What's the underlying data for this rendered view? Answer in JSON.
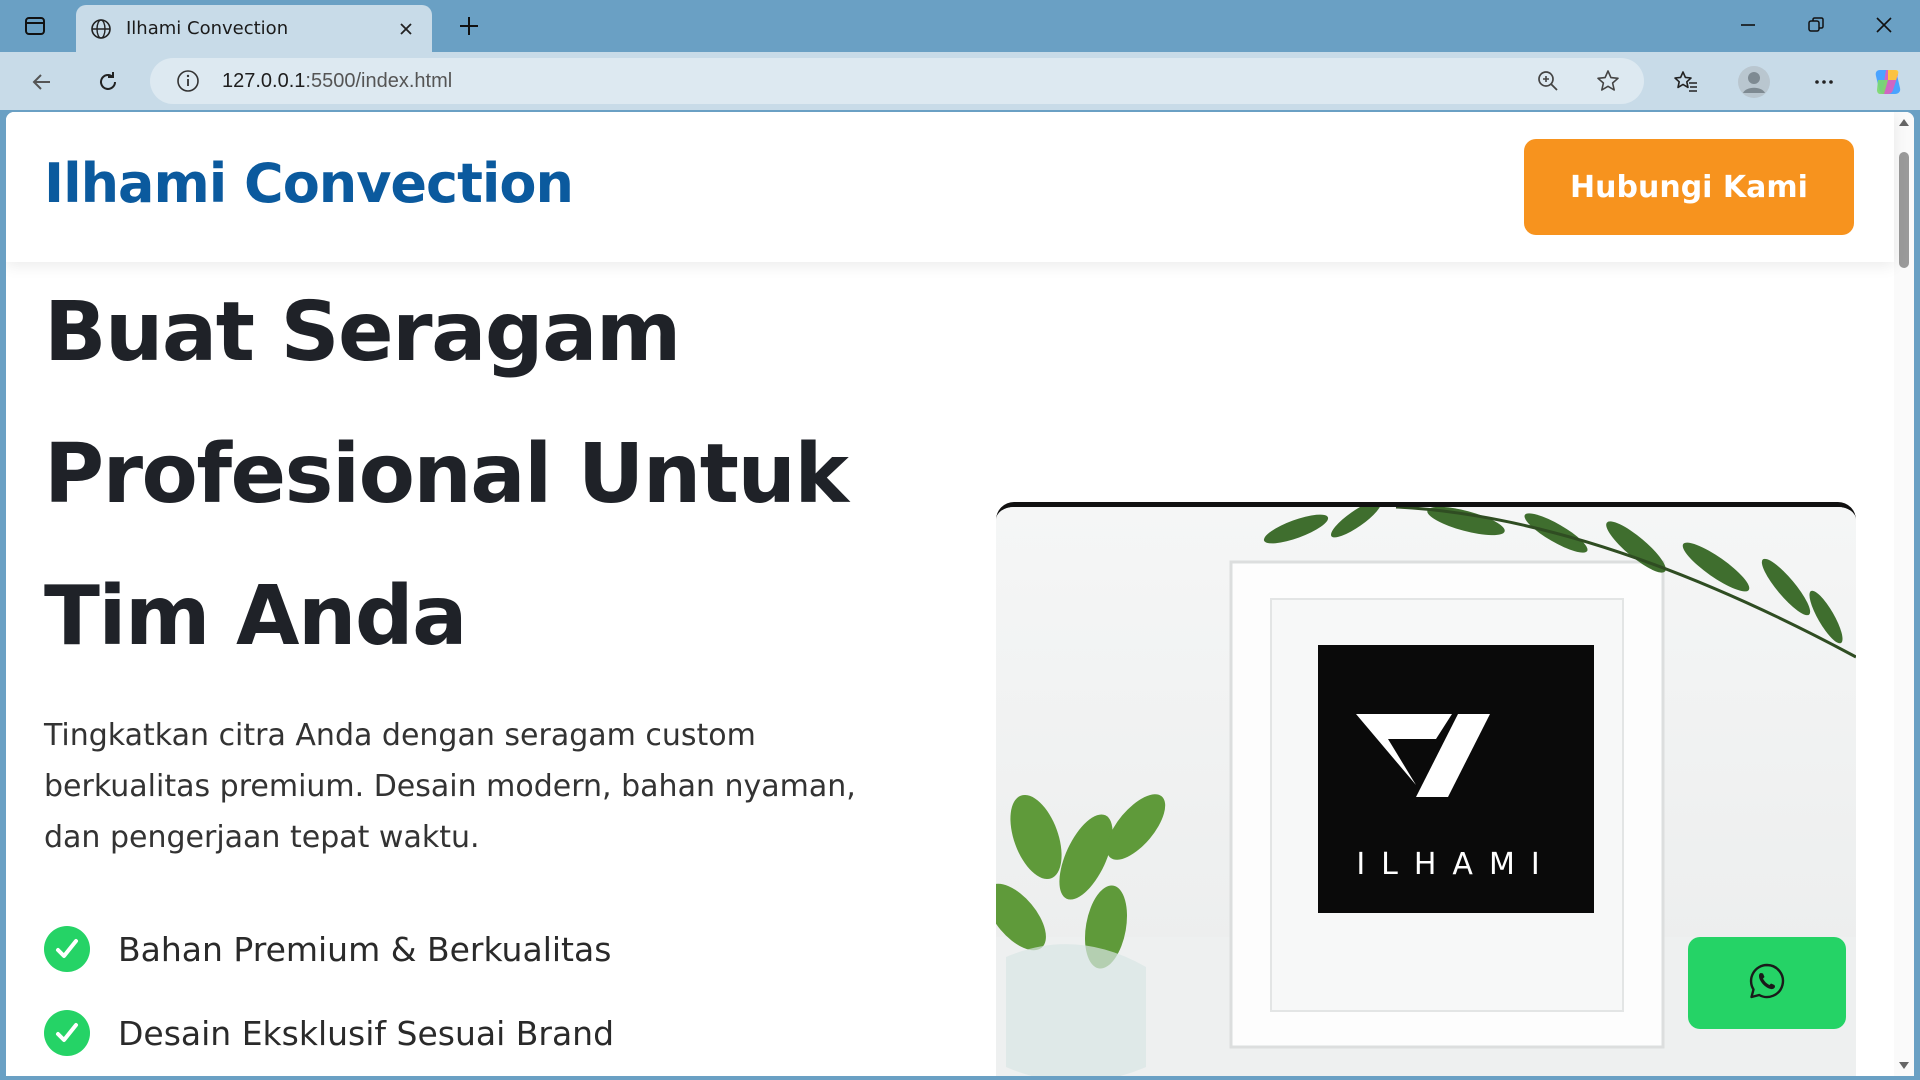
{
  "browser": {
    "tab_title": "Ilhami Convection",
    "url_host": "127.0.0.1",
    "url_rest": ":5500/index.html"
  },
  "site": {
    "brand": "Ilhami Convection",
    "cta_label": "Hubungi Kami",
    "hero": {
      "title_lines": [
        "Buat Seragam",
        "Profesional Untuk",
        "Tim Anda"
      ],
      "subtitle": "Tingkatkan citra Anda dengan seragam custom berkualitas premium. Desain modern, bahan nyaman, dan pengerjaan tepat waktu.",
      "features": [
        "Bahan Premium & Berkualitas",
        "Desain Eksklusif Sesuai Brand"
      ]
    },
    "image_logo_text": "ILHAMI"
  },
  "colors": {
    "brand_blue": "#0b5a9e",
    "cta_orange": "#f7931e",
    "check_green": "#25d366",
    "whatsapp_green": "#25d366"
  },
  "icons": [
    "tab-actions-icon",
    "globe-icon",
    "close-icon",
    "plus-icon",
    "minimize-icon",
    "restore-icon",
    "back-icon",
    "refresh-icon",
    "info-icon",
    "zoom-icon",
    "star-icon",
    "favorites-icon",
    "profile-icon",
    "more-icon",
    "copilot-icon",
    "check-icon",
    "whatsapp-icon"
  ]
}
